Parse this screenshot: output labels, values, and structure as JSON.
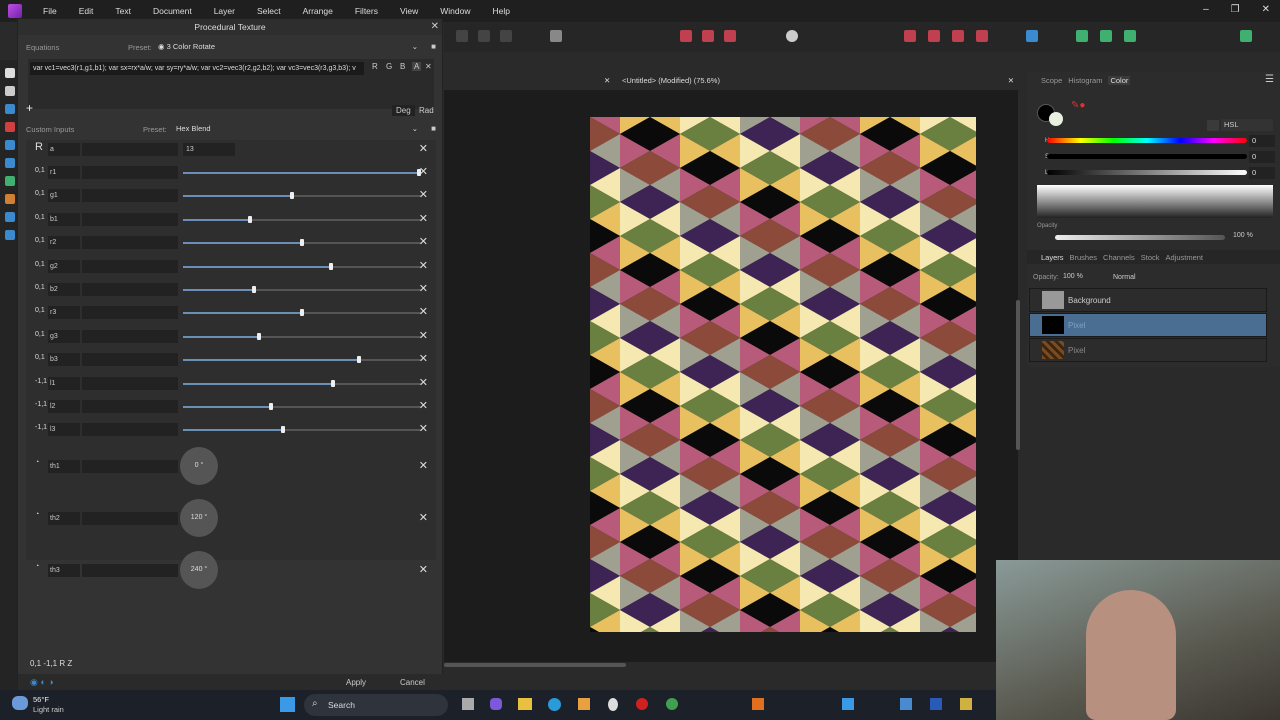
{
  "menu": [
    "File",
    "Edit",
    "Text",
    "Document",
    "Layer",
    "Select",
    "Arrange",
    "Filters",
    "View",
    "Window",
    "Help"
  ],
  "dialog": {
    "title": "Procedural Texture",
    "equations_label": "Equations",
    "preset_label": "Preset:",
    "equations_preset": "3 Color Rotate",
    "equation": "var vc1=vec3(r1,g1,b1); var sx=rx*a/w; var sy=ry*a/w; var vc2=vec3(r2,g2,b2);  var vc3=vec3(r3,g3,b3); v",
    "channels": [
      "R",
      "G",
      "B",
      "A"
    ],
    "add": "+",
    "deg": "Deg",
    "rad": "Rad",
    "custom_label": "Custom Inputs",
    "custom_preset": "Hex Blend",
    "a_input": {
      "type": "R",
      "name": "a",
      "value": "13"
    },
    "sliders": [
      {
        "type": "0,1",
        "name": "r1",
        "value": 0.99
      },
      {
        "type": "0,1",
        "name": "g1",
        "value": 0.46
      },
      {
        "type": "0,1",
        "name": "b1",
        "value": 0.28
      },
      {
        "type": "0,1",
        "name": "r2",
        "value": 0.5
      },
      {
        "type": "0,1",
        "name": "g2",
        "value": 0.62
      },
      {
        "type": "0,1",
        "name": "b2",
        "value": 0.3
      },
      {
        "type": "0,1",
        "name": "r3",
        "value": 0.5
      },
      {
        "type": "0,1",
        "name": "g3",
        "value": 0.32
      },
      {
        "type": "0,1",
        "name": "b3",
        "value": 0.74
      },
      {
        "type": "-1,1",
        "name": "l1",
        "value": 0.63
      },
      {
        "type": "-1,1",
        "name": "l2",
        "value": 0.37
      },
      {
        "type": "-1,1",
        "name": "l3",
        "value": 0.42
      }
    ],
    "angles": [
      {
        "name": "th1",
        "value": "0 °"
      },
      {
        "name": "th2",
        "value": "120 °"
      },
      {
        "name": "th3",
        "value": "240 °"
      }
    ],
    "footer_types": "0,1  -1,1  R  Z",
    "apply": "Apply",
    "cancel": "Cancel"
  },
  "document": {
    "tab": "<Untitled> (Modified) (75.6%)",
    "palette": [
      "#8b4a3a",
      "#e8c060",
      "#3d2455",
      "#b85a7a",
      "#6a8040",
      "#a0a090",
      "#0a0a0a",
      "#f5e8b0"
    ]
  },
  "color_panel": {
    "tabs": [
      "Scope",
      "Histogram",
      "Color"
    ],
    "mode": "HSL",
    "h_label": "H:",
    "s_label": "S:",
    "l_label": "L:",
    "h": "0",
    "s": "0",
    "l": "0",
    "opacity_label": "Opacity",
    "opacity": "100 %"
  },
  "layers_panel": {
    "tabs": [
      "Layers",
      "Brushes",
      "Channels",
      "Stock",
      "Adjustment"
    ],
    "opacity_label": "Opacity:",
    "opacity": "100 %",
    "blend": "Normal",
    "layers": [
      {
        "name": "Background"
      },
      {
        "name": "Pixel"
      },
      {
        "name": "Pixel"
      }
    ]
  },
  "taskbar": {
    "temp": "56°F",
    "weather": "Light rain",
    "search": "Search"
  }
}
